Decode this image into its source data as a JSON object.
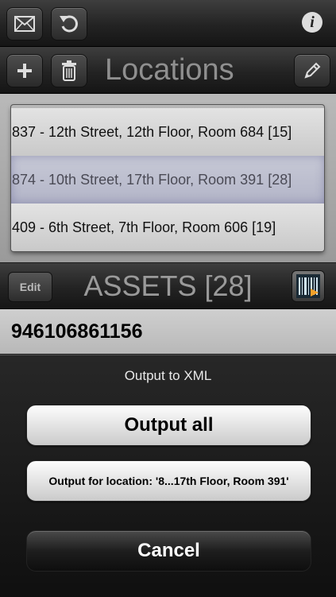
{
  "toolbar": {
    "icons": [
      "mail-icon",
      "refresh-icon",
      "info-icon"
    ],
    "info_glyph": "i"
  },
  "locations_bar": {
    "title": "Locations",
    "icons": [
      "plus-icon",
      "trash-icon",
      "pencil-icon"
    ]
  },
  "locations": [
    {
      "label": "837 - 12th Street, 12th Floor, Room 684 [15]",
      "selected": false
    },
    {
      "label": "874 - 10th Street, 17th Floor, Room 391 [28]",
      "selected": true
    },
    {
      "label": "409 - 6th Street, 7th Floor, Room 606 [19]",
      "selected": false
    }
  ],
  "assets_bar": {
    "edit_label": "Edit",
    "title": "ASSETS [28]",
    "barcode_icon": "barcode-icon"
  },
  "asset": {
    "code": "946106861156"
  },
  "action_sheet": {
    "title": "Output to XML",
    "output_all": "Output all",
    "output_location": "Output for location: '8...17th Floor, Room 391'",
    "cancel": "Cancel"
  },
  "colors": {
    "selected_row": "#b3b5c8",
    "bar_dark": "#232323"
  }
}
